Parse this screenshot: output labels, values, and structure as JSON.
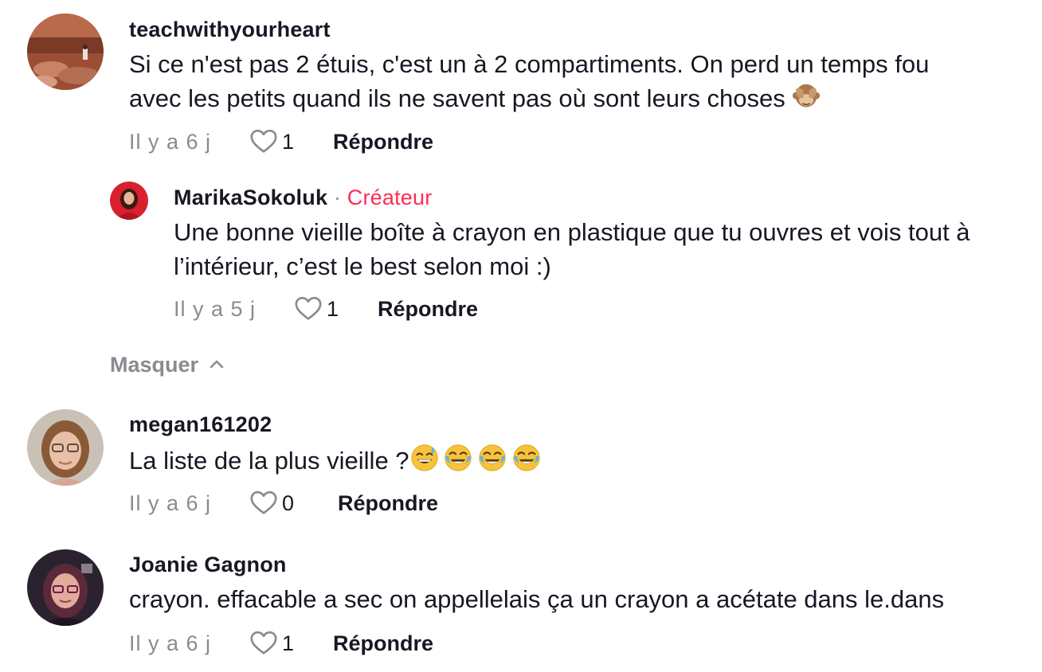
{
  "comments": [
    {
      "username": "teachwithyourheart",
      "text_line1": "Si ce n'est pas 2 étuis, c'est un à 2 compartiments. On perd un temps fou",
      "text_line2": "avec les petits quand ils ne savent pas où sont leurs choses",
      "time": "Il y a 6 j",
      "likes": "1",
      "reply_label": "Répondre",
      "emoji": "see-no-evil-monkey"
    },
    {
      "username": "MarikaSokoluk",
      "separator": "·",
      "creator_label": "Créateur",
      "text_line1": "Une bonne vieille boîte à crayon en plastique que tu ouvres et vois tout à",
      "text_line2": "l’intérieur, c’est le best selon moi :)",
      "time": "Il y a 5 j",
      "likes": "1",
      "reply_label": "Répondre"
    },
    {
      "username": "megan161202",
      "text_line1": "La liste de la plus vieille ?",
      "emojis": [
        "grinning-sweat",
        "tears-of-joy",
        "tears-of-joy",
        "tears-of-joy"
      ],
      "time": "Il y a 6 j",
      "likes": "0",
      "reply_label": "Répondre"
    },
    {
      "username": "Joanie Gagnon",
      "text_line1": "crayon. effacable a sec on appellelais ça un crayon a acétate dans le.dans",
      "time": "Il y a 6 j",
      "likes": "1",
      "reply_label": "Répondre"
    }
  ],
  "hide_replies_label": "Masquer",
  "colors": {
    "accent": "#fe2c55",
    "muted": "#8a8b91",
    "text": "#161823"
  }
}
